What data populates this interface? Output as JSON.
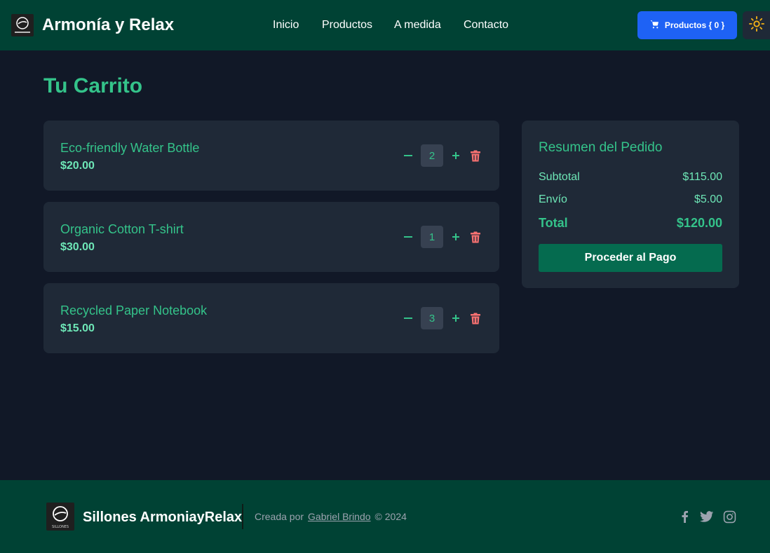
{
  "header": {
    "brand": "Armonía y Relax",
    "nav": [
      "Inicio",
      "Productos",
      "A medida",
      "Contacto"
    ],
    "cart_label": "Productos { 0 }"
  },
  "main": {
    "title": "Tu Carrito",
    "items": [
      {
        "name": "Eco-friendly Water Bottle",
        "price": "$20.00",
        "qty": "2"
      },
      {
        "name": "Organic Cotton T-shirt",
        "price": "$30.00",
        "qty": "1"
      },
      {
        "name": "Recycled Paper Notebook",
        "price": "$15.00",
        "qty": "3"
      }
    ]
  },
  "summary": {
    "title": "Resumen del Pedido",
    "subtotal_label": "Subtotal",
    "subtotal_value": "$115.00",
    "shipping_label": "Envío",
    "shipping_value": "$5.00",
    "total_label": "Total",
    "total_value": "$120.00",
    "checkout_label": "Proceder al Pago"
  },
  "footer": {
    "brand": "Sillones ArmoniayRelax",
    "created_by": "Creada por",
    "author": "Gabriel Brindo",
    "year": "© 2024",
    "logo_text": "SILLONES"
  },
  "colors": {
    "header_bg": "#004234",
    "page_bg": "#111827",
    "card_bg": "#1f2937",
    "accent_green": "#34c38a",
    "cart_button": "#1e62f5",
    "checkout_button": "#056b4f",
    "delete_red": "#f87171",
    "sun_yellow": "#f5b316"
  },
  "icons": [
    "cart-icon",
    "sun-icon",
    "minus-icon",
    "plus-icon",
    "trash-icon",
    "facebook-icon",
    "twitter-icon",
    "instagram-icon"
  ]
}
